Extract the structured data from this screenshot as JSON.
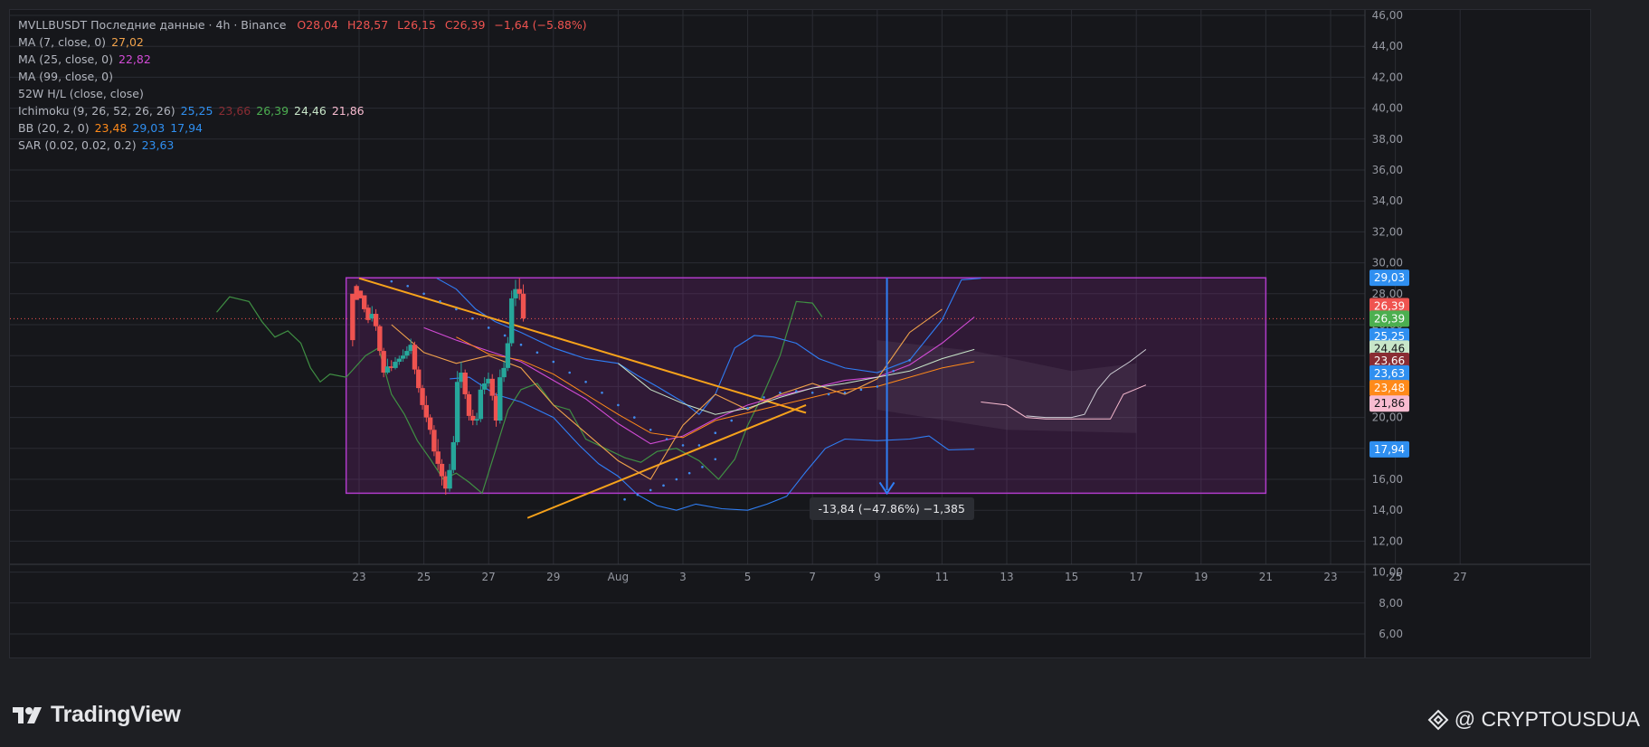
{
  "legend": {
    "title": "MVLLBUSDT Последние данные · 4h · Binance",
    "ohlc": {
      "o": "O28,04",
      "h": "H28,57",
      "l": "L26,15",
      "c": "C26,39",
      "chg": "−1,64 (−5.88%)"
    },
    "indicators": [
      {
        "label": "MA (7, close, 0)",
        "values": [
          {
            "text": "27,02",
            "color": "#f0a24b"
          }
        ]
      },
      {
        "label": "MA (25, close, 0)",
        "values": [
          {
            "text": "22,82",
            "color": "#d24bd6"
          }
        ]
      },
      {
        "label": "MA (99, close, 0)",
        "values": []
      },
      {
        "label": "52W H/L (close, close)",
        "values": []
      },
      {
        "label": "Ichimoku (9, 26, 52, 26, 26)",
        "values": [
          {
            "text": "25,25",
            "color": "#2f8ff0"
          },
          {
            "text": "23,66",
            "color": "#8a2c33"
          },
          {
            "text": "26,39",
            "color": "#4caf50"
          },
          {
            "text": "24,46",
            "color": "#c8e6c9"
          },
          {
            "text": "21,86",
            "color": "#f8bbd0"
          }
        ]
      },
      {
        "label": "BB (20, 2, 0)",
        "values": [
          {
            "text": "23,48",
            "color": "#ff8a1a"
          },
          {
            "text": "29,03",
            "color": "#2f8ff0"
          },
          {
            "text": "17,94",
            "color": "#2f8ff0"
          }
        ]
      },
      {
        "label": "SAR (0.02, 0.02, 0.2)",
        "values": [
          {
            "text": "23,63",
            "color": "#2f8ff0"
          }
        ]
      }
    ]
  },
  "measure_label": "-13,84 (−47.86%) −1,385",
  "footer": {
    "brand": "TradingView",
    "watermark": "@ CRYPTOUSDUA"
  },
  "colors": {
    "up": "#26a69a",
    "down": "#ef5350",
    "box_border": "#b03bc9",
    "box_fill": "rgba(140,40,150,0.22)",
    "trendline": "#f7a21b",
    "arrow": "#2f7ef5",
    "grid": "#2a2c33",
    "axis_text": "#9598a1"
  },
  "chart_data": {
    "type": "candlestick",
    "title": "MVLLBUSDT Последние данные · 4h · Binance",
    "x_ticks": [
      "23",
      "25",
      "27",
      "29",
      "Aug",
      "3",
      "5",
      "7",
      "9",
      "11",
      "13",
      "15",
      "17",
      "19",
      "21",
      "23",
      "25",
      "27"
    ],
    "y_ticks": [
      "46,00",
      "44,00",
      "42,00",
      "40,00",
      "38,00",
      "36,00",
      "34,00",
      "32,00",
      "30,00",
      "28,00",
      "26,00",
      "24,00",
      "22,00",
      "20,00",
      "18,00",
      "16,00",
      "14,00",
      "12,00",
      "10,00",
      "8,00",
      "6,00"
    ],
    "ylim": [
      4,
      47
    ],
    "candles": [
      [
        28.0,
        28.3,
        25.0,
        24.6,
        25.0
      ],
      [
        28.5,
        28.9,
        27.6,
        27.8,
        28.6
      ],
      [
        28.2,
        28.5,
        27.7,
        27.9,
        28.2
      ],
      [
        27.9,
        27.9,
        27.0,
        26.8,
        27.0
      ],
      [
        27.1,
        27.3,
        26.3,
        26.1,
        27.3
      ],
      [
        26.4,
        27.0,
        26.7,
        26.2,
        27.2
      ],
      [
        26.7,
        26.8,
        25.9,
        25.6,
        27.0
      ],
      [
        25.9,
        25.9,
        24.3,
        24.0,
        26.0
      ],
      [
        24.3,
        24.3,
        22.9,
        22.6,
        24.5
      ],
      [
        22.9,
        23.5,
        23.3,
        22.8,
        23.8
      ],
      [
        23.3,
        23.6,
        23.2,
        23.0,
        23.7
      ],
      [
        23.2,
        23.8,
        23.6,
        23.1,
        23.9
      ],
      [
        23.6,
        23.9,
        23.8,
        23.4,
        24.0
      ],
      [
        23.8,
        24.2,
        24.0,
        23.6,
        24.4
      ],
      [
        24.0,
        24.4,
        24.3,
        23.8,
        24.6
      ],
      [
        24.3,
        24.9,
        24.7,
        24.1,
        25.1
      ],
      [
        24.7,
        24.7,
        23.1,
        22.8,
        24.9
      ],
      [
        23.1,
        23.1,
        21.9,
        21.6,
        23.3
      ],
      [
        21.9,
        21.9,
        20.8,
        20.5,
        22.1
      ],
      [
        20.8,
        21.1,
        20.0,
        19.7,
        21.4
      ],
      [
        20.0,
        20.0,
        19.2,
        18.9,
        20.2
      ],
      [
        19.2,
        19.2,
        17.8,
        17.5,
        19.5
      ],
      [
        17.8,
        18.4,
        17.0,
        16.6,
        18.6
      ],
      [
        17.0,
        17.0,
        16.2,
        15.6,
        17.3
      ],
      [
        16.2,
        16.2,
        15.4,
        15.0,
        16.5
      ],
      [
        15.4,
        16.7,
        16.6,
        15.2,
        17.0
      ],
      [
        16.6,
        18.6,
        18.4,
        16.4,
        18.8
      ],
      [
        18.4,
        22.6,
        22.3,
        18.2,
        23.0
      ],
      [
        22.3,
        23.2,
        22.9,
        21.9,
        23.6
      ],
      [
        22.9,
        22.9,
        21.5,
        21.2,
        23.1
      ],
      [
        21.5,
        21.5,
        20.1,
        19.8,
        21.7
      ],
      [
        20.1,
        20.2,
        19.8,
        19.5,
        20.5
      ],
      [
        19.8,
        20.0,
        19.9,
        19.5,
        20.3
      ],
      [
        19.9,
        22.0,
        21.8,
        19.7,
        22.2
      ],
      [
        21.8,
        22.4,
        22.2,
        21.5,
        22.6
      ],
      [
        22.2,
        22.7,
        22.5,
        22.0,
        22.9
      ],
      [
        22.5,
        22.5,
        21.4,
        21.1,
        22.8
      ],
      [
        21.4,
        21.4,
        19.8,
        19.4,
        21.6
      ],
      [
        19.8,
        22.9,
        22.6,
        19.6,
        23.1
      ],
      [
        22.6,
        23.4,
        23.2,
        22.3,
        23.6
      ],
      [
        23.2,
        25.0,
        24.8,
        23.0,
        25.2
      ],
      [
        24.8,
        28.0,
        27.7,
        24.6,
        28.2
      ],
      [
        27.7,
        28.6,
        28.3,
        27.2,
        28.9
      ],
      [
        28.3,
        28.5,
        28.0,
        27.6,
        29.0
      ],
      [
        28.0,
        28.0,
        26.4,
        26.2,
        28.6
      ]
    ],
    "series": [
      {
        "name": "MA (7, close, 0)",
        "values": []
      },
      {
        "name": "MA (25, close, 0)",
        "values": []
      },
      {
        "name": "Ichimoku (9, 26, 52, 26, 26)",
        "values": []
      },
      {
        "name": "BB (20, 2, 0)",
        "values": []
      },
      {
        "name": "SAR (0.02, 0.02, 0.2)",
        "values": []
      }
    ],
    "price_labels": [
      {
        "text": "29,03",
        "value": 29.03,
        "color": "#2f8ff0"
      },
      {
        "text": "26,39",
        "value": 27.2,
        "color": "#ef5350"
      },
      {
        "text": "26,39",
        "value": 26.39,
        "color": "#4caf50"
      },
      {
        "text": "25,25",
        "value": 25.25,
        "color": "#2f8ff0"
      },
      {
        "text": "24,46",
        "value": 24.46,
        "color": "#c8e6c9"
      },
      {
        "text": "23,66",
        "value": 23.66,
        "color": "#8a2c33"
      },
      {
        "text": "23,63",
        "value": 22.85,
        "color": "#2f8ff0"
      },
      {
        "text": "23,48",
        "value": 21.9,
        "color": "#ff8a1a"
      },
      {
        "text": "21,86",
        "value": 20.9,
        "color": "#f8bbd0"
      },
      {
        "text": "17,94",
        "value": 17.94,
        "color": "#2f8ff0"
      }
    ],
    "grid": true
  }
}
